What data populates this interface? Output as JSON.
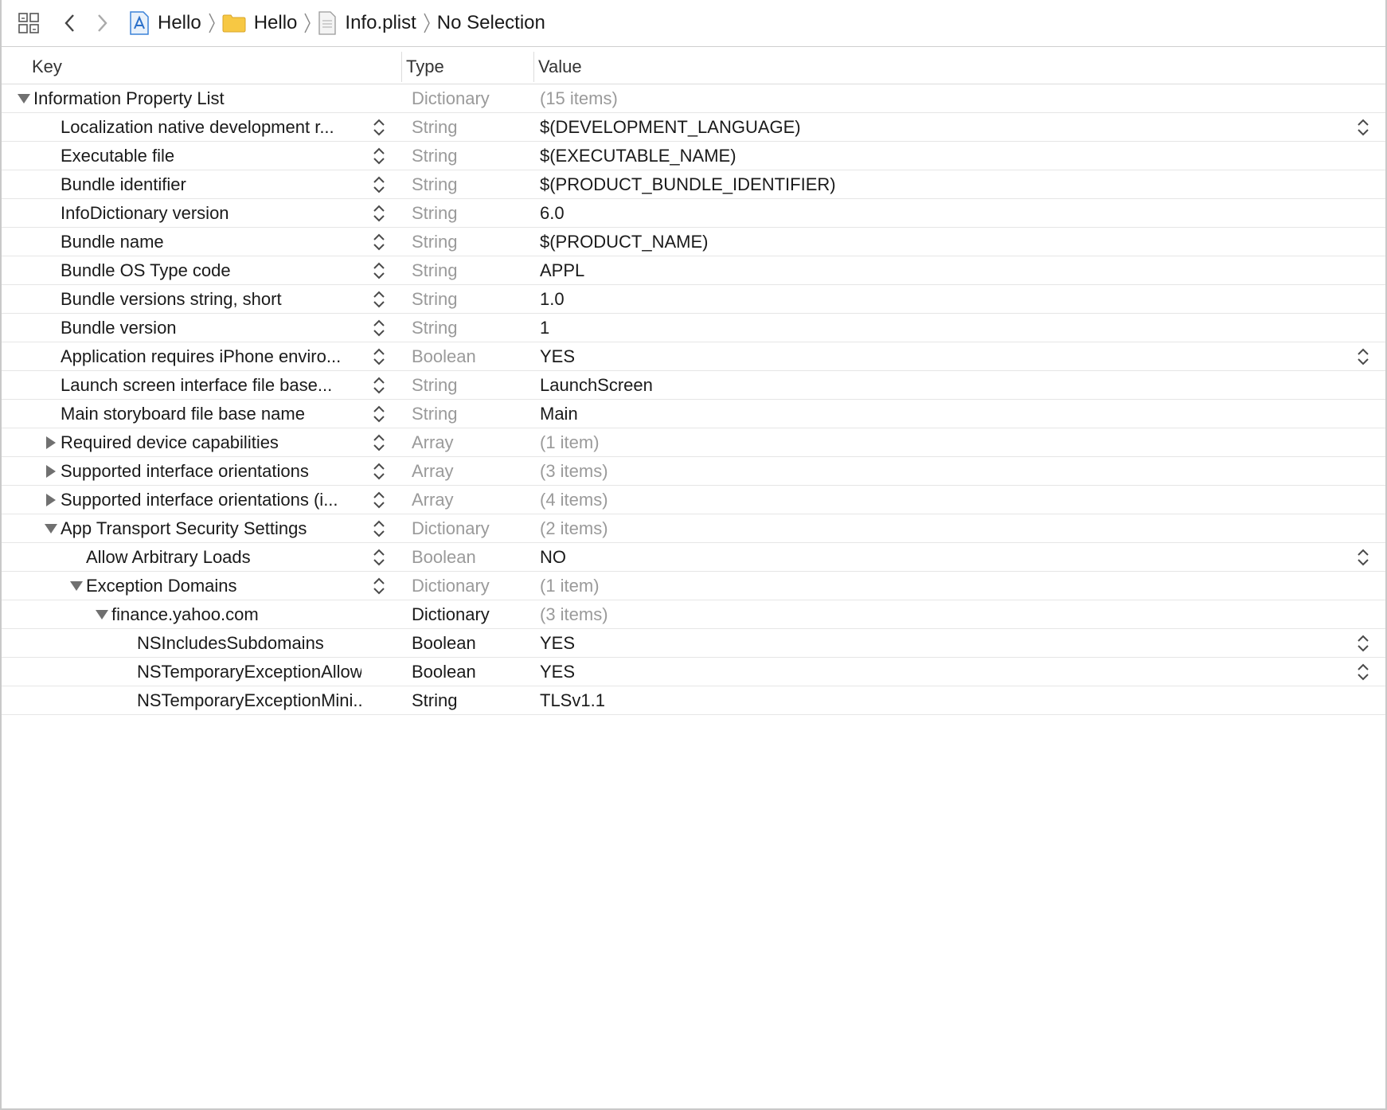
{
  "jumpbar": {
    "crumbs": [
      {
        "label": "Hello",
        "icon": "xcode-project-icon"
      },
      {
        "label": "Hello",
        "icon": "folder-icon"
      },
      {
        "label": "Info.plist",
        "icon": "plist-file-icon"
      },
      {
        "label": "No Selection",
        "icon": ""
      }
    ]
  },
  "columns": {
    "key": "Key",
    "type": "Type",
    "value": "Value"
  },
  "rows": [
    {
      "key": "Information Property List",
      "type": "Dictionary",
      "value": "(15 items)",
      "level": 0,
      "disclosure": "open",
      "key_stepper": false,
      "value_stepper": false,
      "type_dim": true,
      "value_dim": true
    },
    {
      "key": "Localization native development r...",
      "type": "String",
      "value": "$(DEVELOPMENT_LANGUAGE)",
      "level": 1,
      "disclosure": "none",
      "key_stepper": true,
      "value_stepper": true,
      "type_dim": true,
      "value_dim": false
    },
    {
      "key": "Executable file",
      "type": "String",
      "value": "$(EXECUTABLE_NAME)",
      "level": 1,
      "disclosure": "none",
      "key_stepper": true,
      "value_stepper": false,
      "type_dim": true,
      "value_dim": false
    },
    {
      "key": "Bundle identifier",
      "type": "String",
      "value": "$(PRODUCT_BUNDLE_IDENTIFIER)",
      "level": 1,
      "disclosure": "none",
      "key_stepper": true,
      "value_stepper": false,
      "type_dim": true,
      "value_dim": false
    },
    {
      "key": "InfoDictionary version",
      "type": "String",
      "value": "6.0",
      "level": 1,
      "disclosure": "none",
      "key_stepper": true,
      "value_stepper": false,
      "type_dim": true,
      "value_dim": false
    },
    {
      "key": "Bundle name",
      "type": "String",
      "value": "$(PRODUCT_NAME)",
      "level": 1,
      "disclosure": "none",
      "key_stepper": true,
      "value_stepper": false,
      "type_dim": true,
      "value_dim": false
    },
    {
      "key": "Bundle OS Type code",
      "type": "String",
      "value": "APPL",
      "level": 1,
      "disclosure": "none",
      "key_stepper": true,
      "value_stepper": false,
      "type_dim": true,
      "value_dim": false
    },
    {
      "key": "Bundle versions string, short",
      "type": "String",
      "value": "1.0",
      "level": 1,
      "disclosure": "none",
      "key_stepper": true,
      "value_stepper": false,
      "type_dim": true,
      "value_dim": false
    },
    {
      "key": "Bundle version",
      "type": "String",
      "value": "1",
      "level": 1,
      "disclosure": "none",
      "key_stepper": true,
      "value_stepper": false,
      "type_dim": true,
      "value_dim": false
    },
    {
      "key": "Application requires iPhone enviro...",
      "type": "Boolean",
      "value": "YES",
      "level": 1,
      "disclosure": "none",
      "key_stepper": true,
      "value_stepper": true,
      "type_dim": true,
      "value_dim": false
    },
    {
      "key": "Launch screen interface file base...",
      "type": "String",
      "value": "LaunchScreen",
      "level": 1,
      "disclosure": "none",
      "key_stepper": true,
      "value_stepper": false,
      "type_dim": true,
      "value_dim": false
    },
    {
      "key": "Main storyboard file base name",
      "type": "String",
      "value": "Main",
      "level": 1,
      "disclosure": "none",
      "key_stepper": true,
      "value_stepper": false,
      "type_dim": true,
      "value_dim": false
    },
    {
      "key": "Required device capabilities",
      "type": "Array",
      "value": "(1 item)",
      "level": 1,
      "disclosure": "closed",
      "key_stepper": true,
      "value_stepper": false,
      "type_dim": true,
      "value_dim": true
    },
    {
      "key": "Supported interface orientations",
      "type": "Array",
      "value": "(3 items)",
      "level": 1,
      "disclosure": "closed",
      "key_stepper": true,
      "value_stepper": false,
      "type_dim": true,
      "value_dim": true
    },
    {
      "key": "Supported interface orientations (i...",
      "type": "Array",
      "value": "(4 items)",
      "level": 1,
      "disclosure": "closed",
      "key_stepper": true,
      "value_stepper": false,
      "type_dim": true,
      "value_dim": true
    },
    {
      "key": "App Transport Security Settings",
      "type": "Dictionary",
      "value": "(2 items)",
      "level": 1,
      "disclosure": "open",
      "key_stepper": true,
      "value_stepper": false,
      "type_dim": true,
      "value_dim": true
    },
    {
      "key": "Allow Arbitrary Loads",
      "type": "Boolean",
      "value": "NO",
      "level": 2,
      "disclosure": "none",
      "key_stepper": true,
      "value_stepper": true,
      "type_dim": true,
      "value_dim": false
    },
    {
      "key": "Exception Domains",
      "type": "Dictionary",
      "value": "(1 item)",
      "level": 2,
      "disclosure": "open",
      "key_stepper": true,
      "value_stepper": false,
      "type_dim": true,
      "value_dim": true
    },
    {
      "key": "finance.yahoo.com",
      "type": "Dictionary",
      "value": "(3 items)",
      "level": 3,
      "disclosure": "open",
      "key_stepper": false,
      "value_stepper": false,
      "type_dim": false,
      "value_dim": true
    },
    {
      "key": "NSIncludesSubdomains",
      "type": "Boolean",
      "value": "YES",
      "level": 4,
      "disclosure": "none",
      "key_stepper": false,
      "value_stepper": true,
      "type_dim": false,
      "value_dim": false
    },
    {
      "key": "NSTemporaryExceptionAllow...",
      "type": "Boolean",
      "value": "YES",
      "level": 4,
      "disclosure": "none",
      "key_stepper": false,
      "value_stepper": true,
      "type_dim": false,
      "value_dim": false
    },
    {
      "key": "NSTemporaryExceptionMini...",
      "type": "String",
      "value": "TLSv1.1",
      "level": 4,
      "disclosure": "none",
      "key_stepper": false,
      "value_stepper": false,
      "type_dim": false,
      "value_dim": false
    }
  ]
}
